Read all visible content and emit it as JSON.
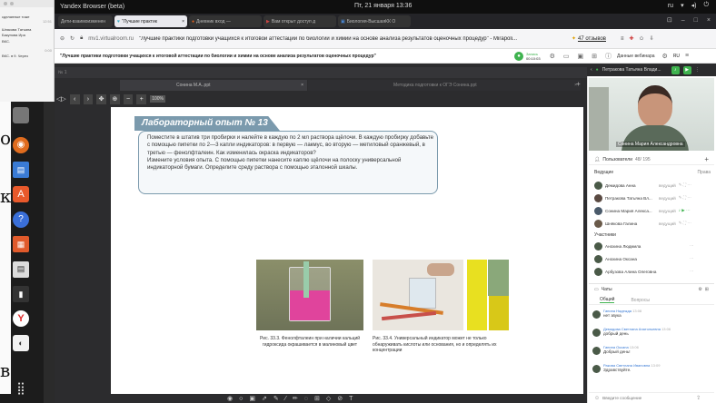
{
  "os_bar": {
    "app_name": "Yandex Browser (beta)",
    "datetime": "Пт, 21 января  13:36",
    "lang": "ru"
  },
  "bg_window": {
    "title": "сделанные тоже",
    "date": "12:51",
    "texts": [
      "Шнякова Татьяна",
      "Бакунова Ира",
      "ВКС.",
      "",
      "0:00",
      "ВКС. в 9. Через"
    ]
  },
  "tabs": [
    {
      "label": "Дети-взаимоизменен",
      "active": false
    },
    {
      "label": "\"Лучшие практик",
      "active": true
    },
    {
      "label": "Дневник вход —",
      "active": false
    },
    {
      "label": "Вам открыт доступ д",
      "active": false
    },
    {
      "label": "Биология-ВысшаяКК О",
      "active": false
    }
  ],
  "address": {
    "domain": "mv1.virtualroom.ru",
    "title": "\"Лучшие практики подготовки учащихся к итоговой аттестации по биологии и химии на основе анализа результатов оценочных процедур\" - Mirapoli...",
    "reviews": "47 отзывов"
  },
  "meeting": {
    "title": "\"Лучшие практики подготовки учащихся к итоговой аттестации по биологии и химии на основе анализа результатов оценочных процедур\"",
    "rec_label": "Запись",
    "rec_time": "00:10:03",
    "participants_button": "Данные вебинара"
  },
  "pres_tabs": [
    {
      "label": "Сонина М.А..ppt"
    },
    {
      "label": "Методика подготовки к ОГЭ Сонина.ppt"
    }
  ],
  "toolbar": {
    "page": "1",
    "zoom": "100%"
  },
  "slide": {
    "heading": "Лабораторный опыт № 13",
    "body": "Поместите в штатив три пробирки и налейте в каждую по 2 мл раствора щёлочи. В каждую пробирку добавьте с помощью пипетки по 2—3 капли индикаторов: в первую — лакмус, во вторую — метиловый оранжевый, в третью — фенолфталеин. Как изменилась окраска индикаторов?\nИзмените условия опыта. С помощью пипетки нанесите каплю щёлочи на полоску универсальной индикаторной бумаги. Определите среду раствора с помощью эталонной шкалы.",
    "caption1": "Рис. 33.3. Фенолфталеин при наличии кальций гидроксида окрашивается в малиновый цвет",
    "caption2": "Рис. 33.4. Универсальный индикатор может не только обнаруживать кислоты или основания, но и определять их концентрации"
  },
  "left_partial": [
    "о",
    "к",
    "",
    "",
    "",
    "в"
  ],
  "speaker": {
    "name": "Петракова Татьяна Влади...",
    "video_label": "Сонина Мария Александровна"
  },
  "users": {
    "title": "Пользователи",
    "count": "48/ 195",
    "leaders_label": "Ведущие",
    "rights_label": "Права",
    "leaders": [
      {
        "name": "Демидова Анна",
        "role": "ведущий",
        "color": "#4a5a48"
      },
      {
        "name": "Петракова Татьяна Вл...",
        "role": "ведущий",
        "color": "#5a4a42"
      },
      {
        "name": "Сонина Мария Алекса...",
        "role": "ведущий",
        "color": "#4a5a6a"
      },
      {
        "name": "Шнякова Галина",
        "role": "ведущий",
        "color": "#6a5a4a"
      }
    ],
    "participants_label": "Участники",
    "participants": [
      {
        "name": "Анохина Людмила",
        "color": "#4a5a48"
      },
      {
        "name": "Анохина Оксана",
        "color": "#4a5a48"
      },
      {
        "name": "Арбузова Алина Олеговна",
        "color": "#4a5a48"
      }
    ]
  },
  "chat": {
    "title": "Чаты",
    "tab_general": "Общий",
    "tab_questions": "Вопросы",
    "messages": [
      {
        "name": "Ганина Надежда",
        "time": "13:08",
        "text": "нет звука"
      },
      {
        "name": "Демидова Светлана Анатольевна",
        "time": "13:06",
        "text": "добрый день"
      },
      {
        "name": "Ганина Оксана",
        "time": "13:06",
        "text": "Добрый день!"
      },
      {
        "name": "Ракова Светлана Ивановна",
        "time": "13:09",
        "text": "Здравствуйте."
      }
    ],
    "input_placeholder": "Введите сообщение"
  },
  "colors": {
    "accent": "#3fb34f",
    "slide_heading": "#7b9aad",
    "pink": "#e0449c",
    "os_bar": "#0f0f0f"
  }
}
